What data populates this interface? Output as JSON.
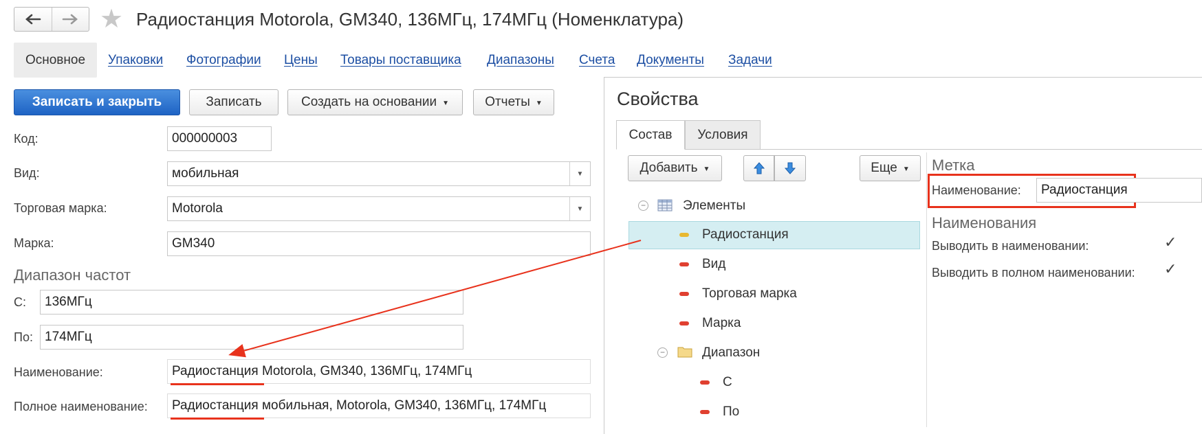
{
  "window": {
    "title": "Радиостанция Motorola, GM340, 136МГц, 174МГц (Номенклатура)",
    "back_icon": "arrow-left-icon",
    "forward_icon": "arrow-right-icon",
    "favorite_icon": "star-icon"
  },
  "tabs": {
    "active": "Основное",
    "links": [
      "Упаковки",
      "Фотографии",
      "Цены",
      "Товары поставщика",
      "Диапазоны",
      "Счета",
      "Документы",
      "Задачи"
    ]
  },
  "toolbar": {
    "save_close": "Записать и закрыть",
    "save": "Записать",
    "create_based": "Создать на основании",
    "reports": "Отчеты"
  },
  "form": {
    "code_label": "Код:",
    "code_value": "000000003",
    "kind_label": "Вид:",
    "kind_value": "мобильная",
    "brand_label": "Торговая марка:",
    "brand_value": "Motorola",
    "model_label": "Марка:",
    "model_value": "GM340",
    "range_group": "Диапазон частот",
    "from_label": "С:",
    "from_value": "136МГц",
    "to_label": "По:",
    "to_value": "174МГц",
    "name_label": "Наименование:",
    "name_value": "Радиостанция Motorola, GM340, 136МГц, 174МГц",
    "fullname_label": "Полное наименование:",
    "fullname_value": "Радиостанция мобильная, Motorola, GM340, 136МГц, 174МГц"
  },
  "properties": {
    "title": "Свойства",
    "tab_composition": "Состав",
    "tab_conditions": "Условия",
    "add_button": "Добавить",
    "more_button": "Еще",
    "tree": {
      "root": "Элементы",
      "items": [
        "Радиостанция",
        "Вид",
        "Торговая марка",
        "Марка"
      ],
      "folder": "Диапазон",
      "sub_items": [
        "С",
        "По"
      ]
    },
    "label_group": "Метка",
    "label_name_label": "Наименование:",
    "label_name_value": "Радиостанция",
    "names_group": "Наименования",
    "show_in_name": "Выводить в наименовании:",
    "show_in_name_checked": true,
    "show_in_full_name": "Выводить в полном наименовании:",
    "show_in_full_name_checked": true
  },
  "colors": {
    "accent_link": "#1d4fa3",
    "primary_button": "#1e63c4",
    "annotation_red": "#e8321c",
    "selection": "#d5eef2"
  }
}
